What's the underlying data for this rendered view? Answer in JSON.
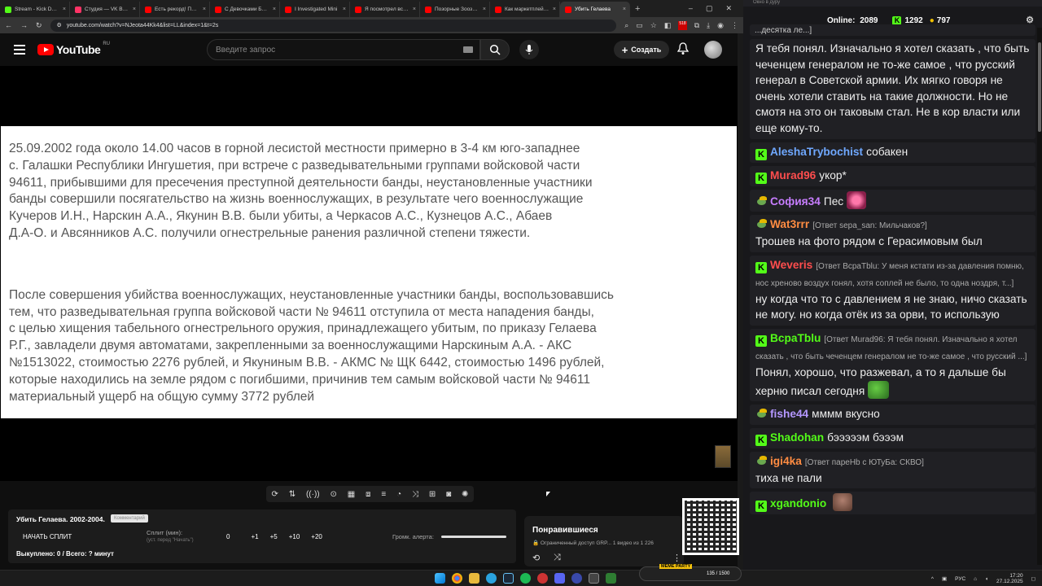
{
  "browser": {
    "tabs": [
      {
        "title": "Stream - Kick Dash",
        "color": "#53fc18"
      },
      {
        "title": "Студия — VK Видео",
        "color": "#ff3366"
      },
      {
        "title": "Есть рекорд! Перв",
        "color": "#ff0000"
      },
      {
        "title": "С Девочками Болт",
        "color": "#ff0000"
      },
      {
        "title": "I Investigated Mini",
        "color": "#ff0000"
      },
      {
        "title": "Я посмотрел все с",
        "color": "#ff0000"
      },
      {
        "title": "Позорные Зоозащ",
        "color": "#ff0000"
      },
      {
        "title": "Как маркетплейсы",
        "color": "#ff0000"
      },
      {
        "title": "Убить Гелаева",
        "color": "#ff0000",
        "active": true
      }
    ],
    "new_tab": "+",
    "url": "youtube.com/watch?v=NJeota44Kk4&list=LL&index=1&t=2s",
    "extension_badge": "518"
  },
  "youtube": {
    "logo_text": "YouTube",
    "region": "RU",
    "search_placeholder": "Введите запрос",
    "create_label": "Создать"
  },
  "video": {
    "paragraph1": "25.09.2002 года около 14.00 часов в горной лесистой местности примерно в 3-4 км юго-западнее\nс. Галашки Республики Ингушетия, при встрече с разведывательными группами войсковой части\n94611, прибывшими для пресечения преступной деятельности банды, неустановленные участники\nбанды  совершили  посягательство на жизнь военнослужащих, в результате чего военнослужащие\nКучеров И.Н., Нарскин А.А., Якунин В.В. были убиты, а Черкасов А.С., Кузнецов А.С., Абаев\nД.А-О.  и Авсянников А.С. получили огнестрельные ранения различной степени тяжести.",
    "paragraph2": "После совершения убийства военнослужащих, неустановленные участники банды,  воспользовавшись\nтем, что разведывательная группа войсковой части № 94611 отступила от места нападения банды,\nс целью хищения табельного огнестрельного оружия, принадлежащего убитым, по приказу Гелаева\nР.Г., завладели двумя автоматами, закрепленными за военнослужащими Нарскиным А.А. - АКС\n№1513022, стоимостью 2276 рублей, и Якуниным В.В. - АКМС № ЩК 6442, стоимостью 1496 рублей,\nкоторые находились на земле рядом с погибшими, причинив тем самым войсковой части № 94611\nматериальный ущерб  на общую сумму 3772 рублей"
  },
  "split_panel": {
    "title": "Убить Гелаева. 2002-2004.",
    "badge": "Комментарий",
    "start_label": "НАЧАТЬ СПЛИТ",
    "split_label": "Сплит (мин):",
    "split_hint": "(уст. перед \"Начать\")",
    "values": [
      "0",
      "+1",
      "+5",
      "+10",
      "+20"
    ],
    "volume_label": "Громк. алерта:",
    "bought": "Выкуплено: 0 / Всего: ? минут"
  },
  "playlist": {
    "title": "Понравившиеся",
    "subtitle": "🔒 Ограниченный доступ GRP... 1 видео из 1 226"
  },
  "chat": {
    "window_title": "Окно в дуру",
    "online_label": "Online:",
    "online_count": "2089",
    "kick_count": "1292",
    "coin_count": "797",
    "messages": [
      {
        "text": "...десятка ле...]",
        "partial": true
      },
      {
        "text": "Я тебя понял. Изначально я хотел сказать , что быть чеченцем генералом не то-же самое , что русский генерал в Советской армии. Их мягко говоря не очень хотели ставить на такие должности. Но не смотя на это он таковым стал. Не в кор власти или еще кому-то."
      },
      {
        "user": "AleshaTrybochist",
        "color": "#6fa8ff",
        "badge": "k",
        "text": "собакен"
      },
      {
        "user": "Murad96",
        "color": "#ff4d4d",
        "badge": "k",
        "text": "укор*"
      },
      {
        "user": "София34",
        "color": "#c77dff",
        "badge": "pepe",
        "text": "Пес",
        "emote": "heart"
      },
      {
        "user": "Wat3rrr",
        "color": "#ff8c42",
        "badge": "pepe",
        "reply": "[Ответ sepa_san: Мильчаков?]",
        "text": "Трошев на фото рядом с Герасимовым был"
      },
      {
        "user": "Weveris",
        "color": "#ff4d4d",
        "badge": "k",
        "reply": "[Ответ ВсраТblu: У меня кстати из-за давления помню, нос хреново воздух гонял, хотя соплей не было, то одна ноздря, т...]",
        "text": "ну когда что то с давлением я не знаю, ничо сказать не могу. но когда отёк из за орви, то использую"
      },
      {
        "user": "ВсраТblu",
        "color": "#53fc18",
        "badge": "k",
        "reply": "[Ответ Murad96: Я тебя понял. Изначально я хотел сказать , что быть чеченцем генералом не то-же самое , что русский ...]",
        "text": "Понял, хорошо, что разжевал, а то я дальше бы херню писал сегодня",
        "emote": "frog"
      },
      {
        "user": "fishe44",
        "color": "#b497ff",
        "badge": "pepe",
        "text": "мммм вкусно"
      },
      {
        "user": "Shadohan",
        "color": "#53fc18",
        "badge": "k",
        "text": "бэээээм бэээм"
      },
      {
        "user": "igi4ka",
        "color": "#ff8c42",
        "badge": "pepe",
        "reply": "[Ответ пареНb с ЮТуБа: СКВО]",
        "text": "тиха не пали"
      },
      {
        "user": "xgandonio",
        "color": "#53fc18",
        "badge": "k",
        "text": "",
        "emote": "face"
      }
    ]
  },
  "taskbar": {
    "meme_label": "MEME PARTY",
    "meme_progress": "135 / 1500",
    "lang": "РУС",
    "time": "17:20",
    "date": "27.12.2025"
  }
}
